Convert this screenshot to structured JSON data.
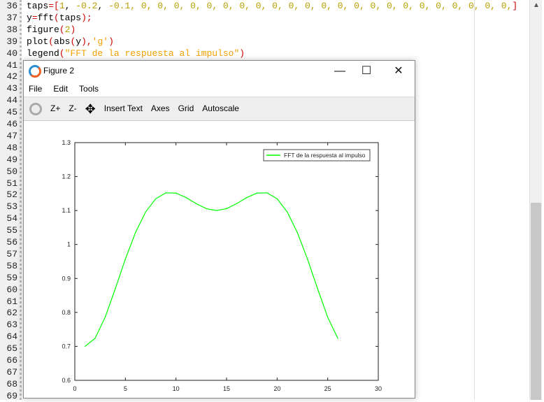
{
  "editor": {
    "line_numbers": [
      36,
      37,
      38,
      39,
      40,
      41,
      42,
      43,
      44,
      45,
      46,
      47,
      48,
      49,
      50,
      51,
      52,
      53,
      54,
      55,
      56,
      57,
      58,
      59,
      60,
      61,
      62,
      63,
      64,
      65,
      66,
      67,
      68,
      69
    ],
    "lines": [
      [
        {
          "t": "taps",
          "c": ""
        },
        {
          "t": "=[",
          "c": "op"
        },
        {
          "t": "1",
          "c": "num"
        },
        {
          "t": ", ",
          "c": ""
        },
        {
          "t": "-0.2",
          "c": "num"
        },
        {
          "t": ", ",
          "c": ""
        },
        {
          "t": "-0.1",
          "c": "num"
        },
        {
          "t": ", 0, 0, 0, 0, 0, 0, 0, 0, 0, 0, 0, 0, 0, 0, 0, 0, 0, 0, 0, 0, 0, 0, 0,",
          "c": "num"
        },
        {
          "t": "]",
          "c": "op"
        }
      ],
      [
        {
          "t": "y",
          "c": ""
        },
        {
          "t": "=",
          "c": "op"
        },
        {
          "t": "fft",
          "c": ""
        },
        {
          "t": "(",
          "c": "op"
        },
        {
          "t": "taps",
          "c": ""
        },
        {
          "t": ");",
          "c": "op"
        }
      ],
      [
        {
          "t": "figure",
          "c": ""
        },
        {
          "t": "(",
          "c": "op"
        },
        {
          "t": "2",
          "c": "num"
        },
        {
          "t": ")",
          "c": "op"
        }
      ],
      [
        {
          "t": "plot",
          "c": ""
        },
        {
          "t": "(",
          "c": "op"
        },
        {
          "t": "abs",
          "c": ""
        },
        {
          "t": "(",
          "c": "op"
        },
        {
          "t": "y",
          "c": ""
        },
        {
          "t": "),",
          "c": "op"
        },
        {
          "t": "'g'",
          "c": "str"
        },
        {
          "t": ")",
          "c": "op"
        }
      ],
      [
        {
          "t": "legend",
          "c": ""
        },
        {
          "t": "(",
          "c": "op"
        },
        {
          "t": "\"FFT de la respuesta al impulso\"",
          "c": "str"
        },
        {
          "t": ")",
          "c": "op"
        }
      ]
    ]
  },
  "figure": {
    "title": "Figure 2",
    "menu": [
      "File",
      "Edit",
      "Tools"
    ],
    "toolbar": {
      "zoom_in": "Z+",
      "zoom_out": "Z-",
      "insert_text": "Insert Text",
      "axes": "Axes",
      "grid": "Grid",
      "autoscale": "Autoscale"
    },
    "window_buttons": {
      "minimize": "—",
      "maximize": "☐",
      "close": "✕"
    }
  },
  "chart_data": {
    "type": "line",
    "x": [
      1,
      2,
      3,
      4,
      5,
      6,
      7,
      8,
      9,
      10,
      11,
      12,
      13,
      14,
      15,
      16,
      17,
      18,
      19,
      20,
      21,
      22,
      23,
      24,
      25,
      26
    ],
    "series": [
      {
        "name": "FFT de la respuesta al impulso",
        "color": "#00ff00",
        "values": [
          0.7,
          0.7235,
          0.7859,
          0.8697,
          0.9573,
          1.0354,
          1.0958,
          1.1347,
          1.1521,
          1.1513,
          1.1382,
          1.1204,
          1.1056,
          1.1,
          1.1056,
          1.1204,
          1.1382,
          1.1513,
          1.1521,
          1.1347,
          1.0958,
          1.0354,
          0.9573,
          0.8697,
          0.7859,
          0.7235
        ]
      }
    ],
    "xlim": [
      0,
      30
    ],
    "ylim": [
      0.6,
      1.3
    ],
    "xticks": [
      "0",
      "5",
      "10",
      "15",
      "20",
      "25",
      "30"
    ],
    "yticks": [
      "0.6",
      "0.7",
      "0.8",
      "0.9",
      "1",
      "1.1",
      "1.2",
      "1.3"
    ],
    "grid": false,
    "legend": "top-right"
  }
}
